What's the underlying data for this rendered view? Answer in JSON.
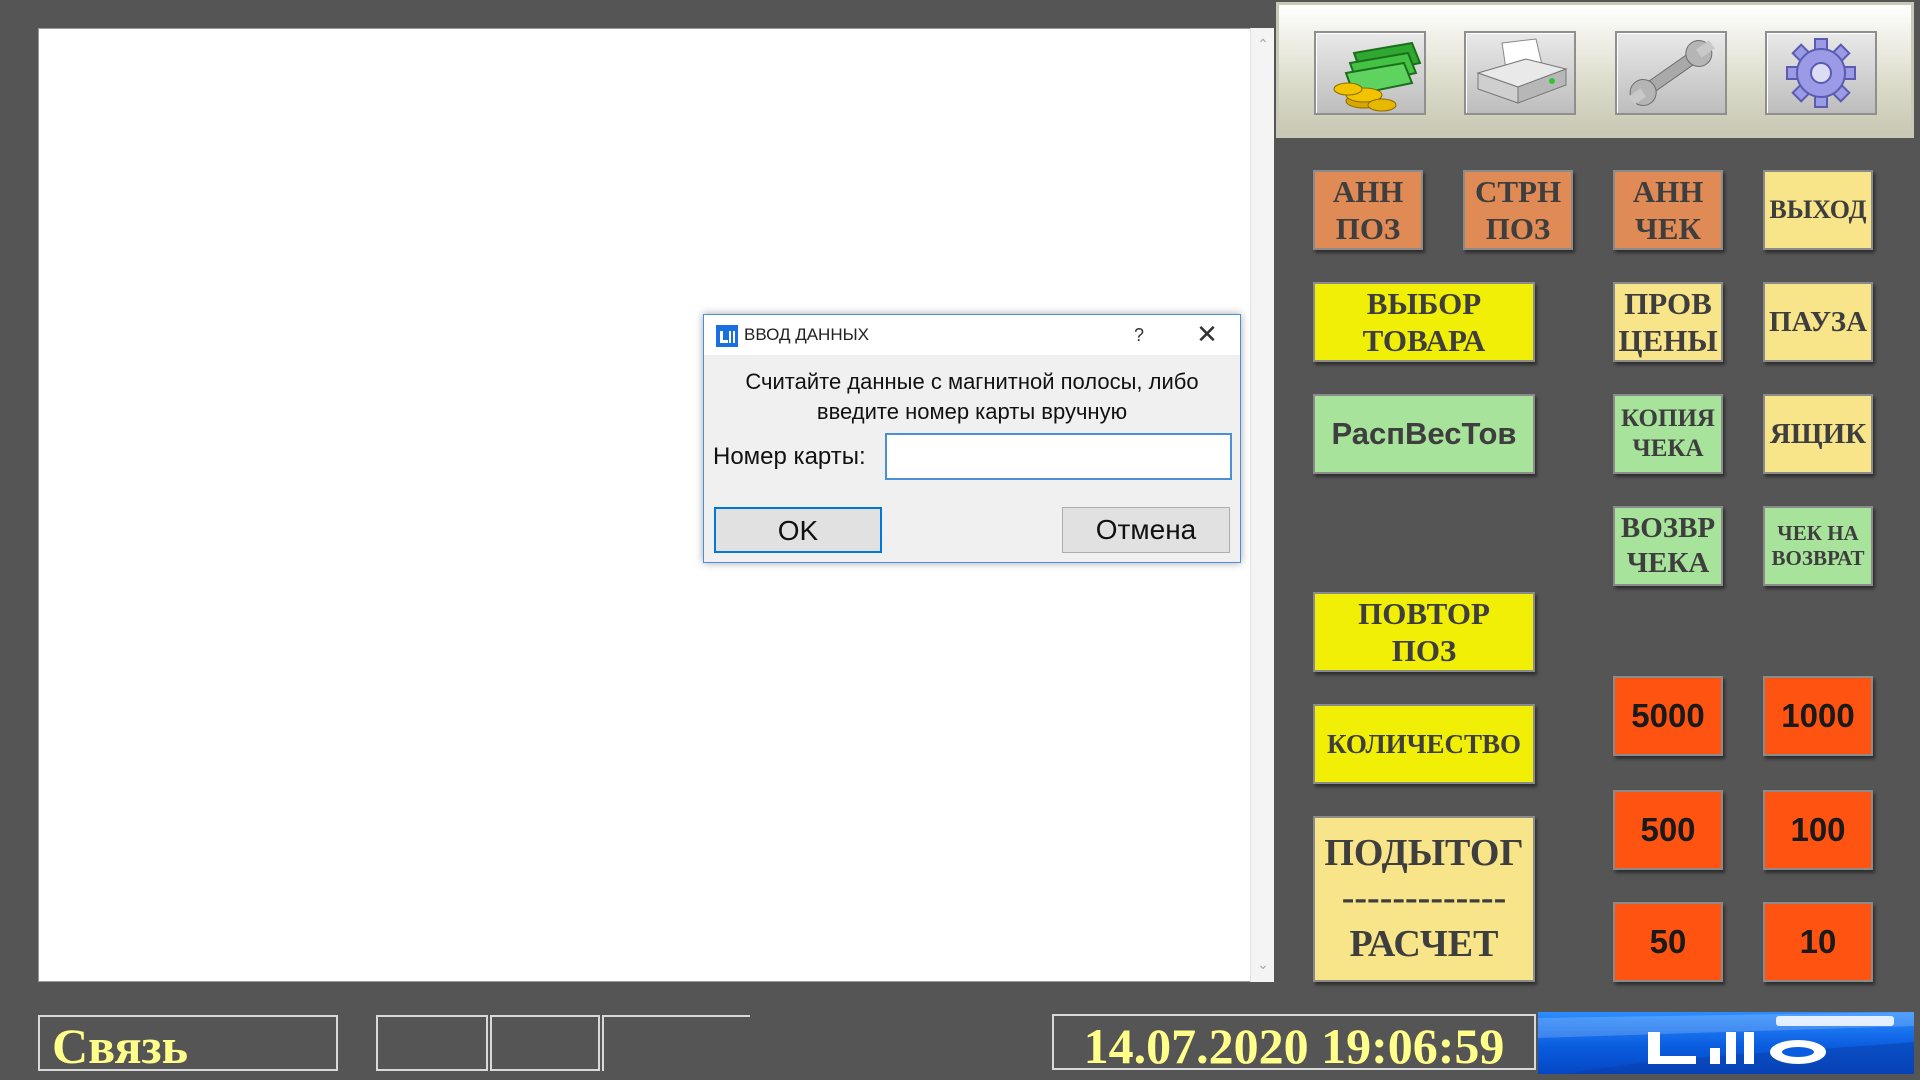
{
  "icons": {
    "toolbar": [
      "money-icon",
      "printer-icon",
      "wrench-icon",
      "gear-icon"
    ]
  },
  "buttons": {
    "ann_poz": "АНН\nПОЗ",
    "strn_poz": "СТРН\nПОЗ",
    "ann_chek": "АНН\nЧЕК",
    "vyhod": "ВЫХОД",
    "vybor_tovara": "ВЫБОР\nТОВАРА",
    "prov_ceny": "ПРОВ\nЦЕНЫ",
    "pauza": "ПАУЗА",
    "raspvestov": "РаспВесТов",
    "kopiya_cheka": "КОПИЯ\nЧЕКА",
    "yashchik": "ЯЩИК",
    "vozvr_cheka": "ВОЗВР\nЧЕКА",
    "chek_na_vozvrat": "ЧЕК НА\nВОЗВРАТ",
    "povtor_poz": "ПОВТОР\nПОЗ",
    "kolichestvo": "КОЛИЧЕСТВО",
    "podytog": "ПОДЫТОГ\n-------------\nРАСЧЕТ",
    "cash_5000": "5000",
    "cash_1000": "1000",
    "cash_500": "500",
    "cash_100": "100",
    "cash_50": "50",
    "cash_10": "10"
  },
  "status": {
    "connection": "Связь",
    "datetime": "14.07.2020 19:06:59"
  },
  "dialog": {
    "title": "ВВОД ДАННЫХ",
    "help": "?",
    "close": "✕",
    "message_line1": "Считайте данные с магнитной полосы, либо",
    "message_line2": "введите номер карты вручную",
    "card_label": "Номер карты:",
    "card_value": "",
    "ok": "OK",
    "cancel": "Отмена"
  },
  "colors": {
    "background": "#555555",
    "orange": "#e08a55",
    "pale_yellow": "#f8e58a",
    "yellow": "#f1ef06",
    "green": "#a7e39a",
    "cash_red": "#ff5312",
    "status_text": "#ffff8a"
  }
}
